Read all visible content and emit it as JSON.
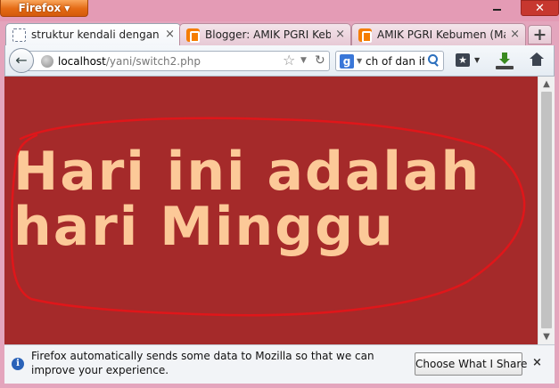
{
  "window": {
    "app_button": "Firefox",
    "close_glyph": "✕"
  },
  "tabs": [
    {
      "label": "struktur kendali dengan S...",
      "favicon": "blank-page-icon",
      "active": true
    },
    {
      "label": "Blogger: AMIK PGRI Kebu...",
      "favicon": "blogger-icon",
      "active": false
    },
    {
      "label": "AMIK PGRI Kebumen (Ma...",
      "favicon": "blogger-icon",
      "active": false
    }
  ],
  "tab_close_glyph": "×",
  "new_tab_glyph": "+",
  "navbar": {
    "url_host": "localhost",
    "url_path": "/yani/switch2.php",
    "search_engine": "g",
    "search_text": "ch of dan if"
  },
  "content": {
    "background_color": "#a52a2a",
    "text_color": "#fcc998",
    "outline_color": "#e0161a",
    "line1": "Hari ini adalah",
    "line2": "hari Minggu"
  },
  "notification": {
    "message": "Firefox automatically sends some data to Mozilla so that we can improve your experience.",
    "button": "Choose What I Share",
    "close_glyph": "×"
  }
}
